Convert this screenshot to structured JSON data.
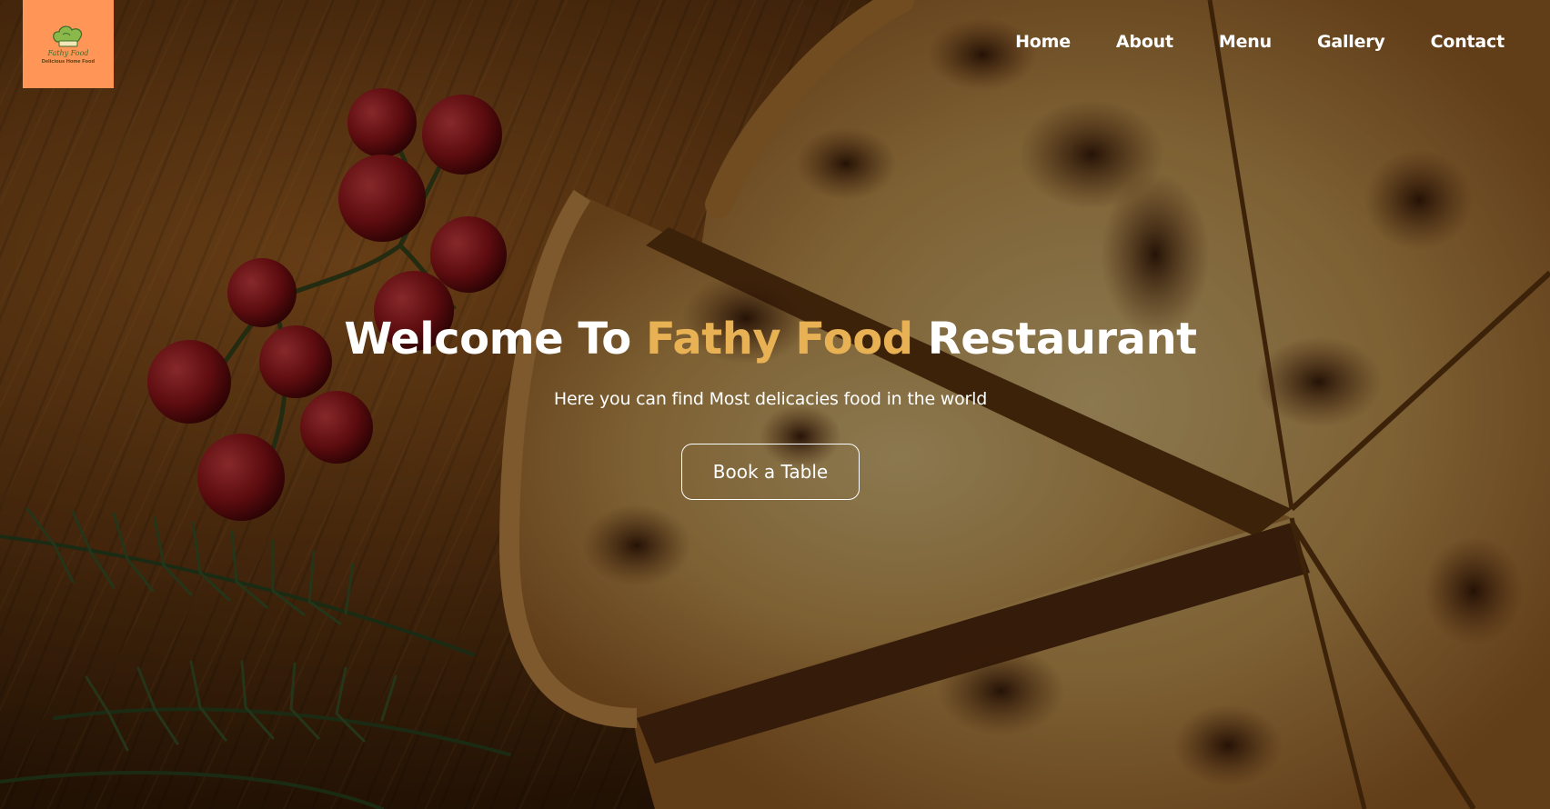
{
  "brand": {
    "logo_script": "Fathy Food",
    "logo_tagline": "Delicious Home Food",
    "logo_bg": "#ff9557",
    "logo_icon": "chef-hat-icon"
  },
  "nav": {
    "items": [
      {
        "label": "Home"
      },
      {
        "label": "About"
      },
      {
        "label": "Menu"
      },
      {
        "label": "Gallery"
      },
      {
        "label": "Contact"
      }
    ]
  },
  "hero": {
    "title_prefix": "Welcome To ",
    "title_accent": "Fathy Food",
    "title_suffix": " Restaurant",
    "subtitle": "Here you can find Most delicacies food in the world",
    "cta_label": "Book a Table",
    "accent_color": "#e8b254",
    "background_image": "pizza-on-wooden-board-with-cherry-tomatoes-and-rosemary"
  }
}
